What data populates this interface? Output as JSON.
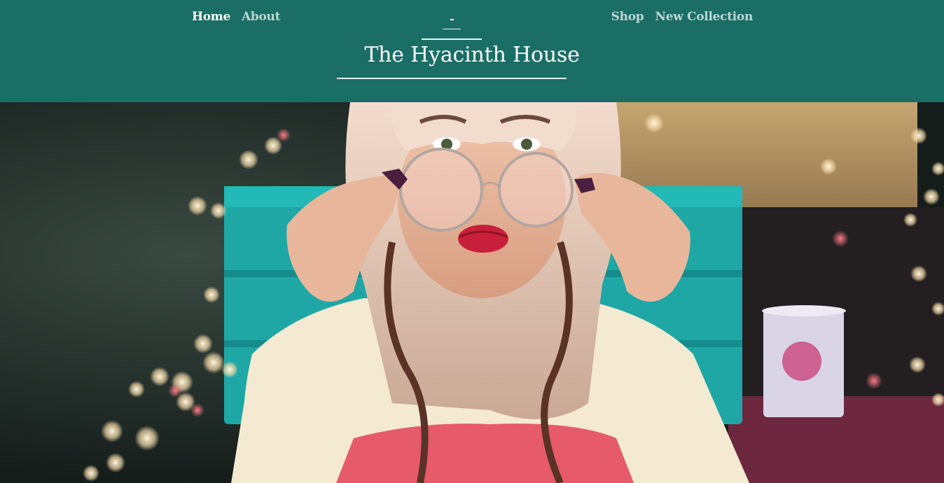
{
  "header": {
    "nav_left": [
      {
        "label": "Home",
        "active": true
      },
      {
        "label": "About",
        "active": false
      }
    ],
    "nav_right": [
      {
        "label": "Shop",
        "active": false
      },
      {
        "label": "New Collection",
        "active": false
      }
    ],
    "site_title": "The Hyacinth House",
    "background_color": "#1a6e66",
    "text_color": "#ffffff",
    "inactive_link_color": "#bfd6d2"
  },
  "hero": {
    "image_description_icon": "hero-photo",
    "accent_colors": [
      "#2ab0ad",
      "#e8dcc0",
      "#e2495a",
      "#2b3a35"
    ]
  }
}
